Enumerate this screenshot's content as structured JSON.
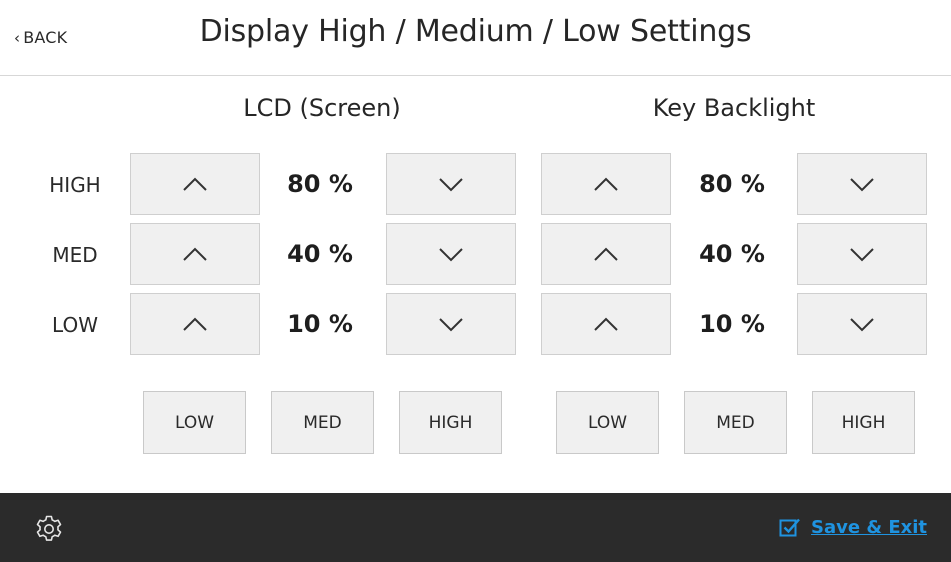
{
  "header": {
    "back_label": "BACK",
    "title": "Display High / Medium / Low Settings"
  },
  "sections": {
    "lcd": {
      "title": "LCD (Screen)"
    },
    "backlight": {
      "title": "Key Backlight"
    }
  },
  "rows": [
    {
      "label": "HIGH",
      "lcd_value": "80 %",
      "backlight_value": "80 %"
    },
    {
      "label": "MED",
      "lcd_value": "40 %",
      "backlight_value": "40 %"
    },
    {
      "label": "LOW",
      "lcd_value": "10 %",
      "backlight_value": "10 %"
    }
  ],
  "presets": {
    "lcd": [
      "LOW",
      "MED",
      "HIGH"
    ],
    "backlight": [
      "LOW",
      "MED",
      "HIGH"
    ]
  },
  "footer": {
    "save_exit_label": "Save & Exit",
    "icons": {
      "settings": "gear-icon",
      "save": "checkbox-icon"
    },
    "accent_color": "#1f93e0",
    "background_color": "#2b2b2b"
  },
  "icons": {
    "increase": "chevron-up-icon",
    "decrease": "chevron-down-icon",
    "back": "chevron-left-icon"
  }
}
